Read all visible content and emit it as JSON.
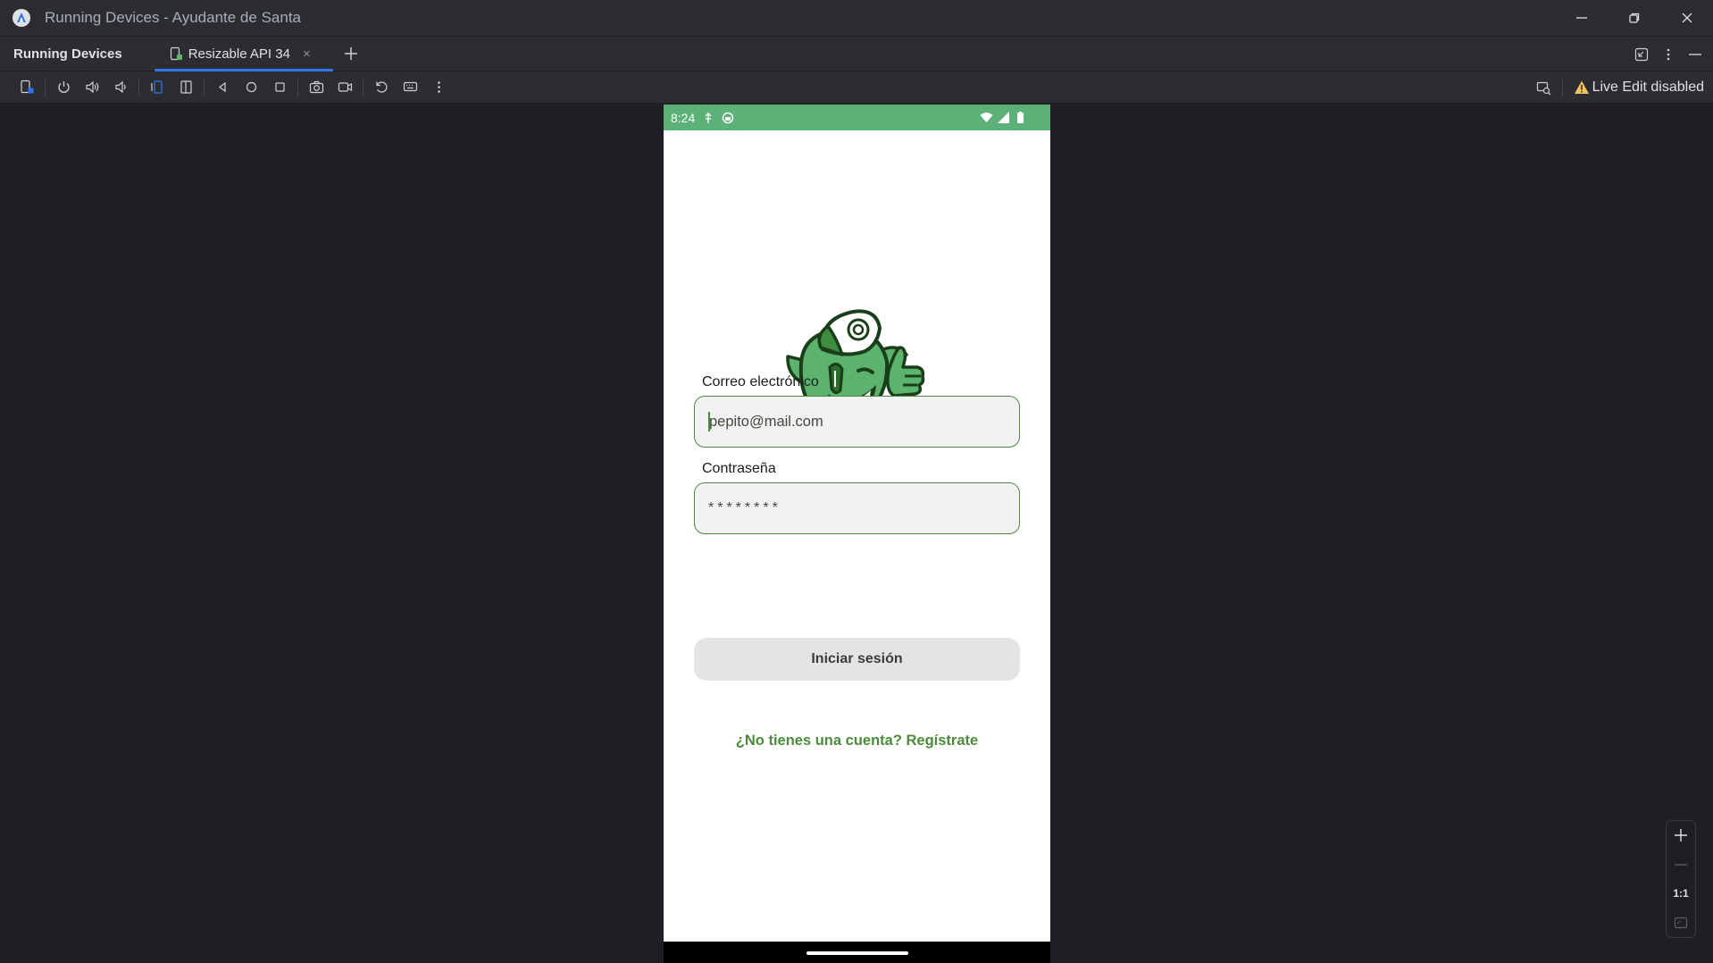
{
  "window": {
    "title": "Running Devices - Ayudante de Santa",
    "controls": [
      "minimize-icon",
      "restore-icon",
      "close-icon"
    ]
  },
  "tabbar": {
    "tool_window_title": "Running Devices",
    "device_tab_label": "Resizable API 34",
    "close_glyph": "×"
  },
  "toolbar": {
    "icons": [
      "device-mirror-icon",
      "power-icon",
      "volume-up-icon",
      "volume-down-icon",
      "rotate-left-icon",
      "rotate-right-icon",
      "back-icon",
      "home-icon",
      "overview-icon",
      "screenshot-icon",
      "screen-record-icon",
      "reset-icon",
      "keyboard-icon",
      "more-icon"
    ],
    "live_edit_label": "Live Edit disabled"
  },
  "phone": {
    "status_time": "8:24",
    "accent_color": "#5bb178",
    "email_label": "Correo electrónico",
    "email_value": "pepito@mail.com",
    "password_label": "Contraseña",
    "password_value": "********",
    "login_button": "Iniciar sesión",
    "register_link": "¿No tienes una cuenta? Regístrate"
  },
  "zoom": {
    "one_to_one": "1:1"
  }
}
